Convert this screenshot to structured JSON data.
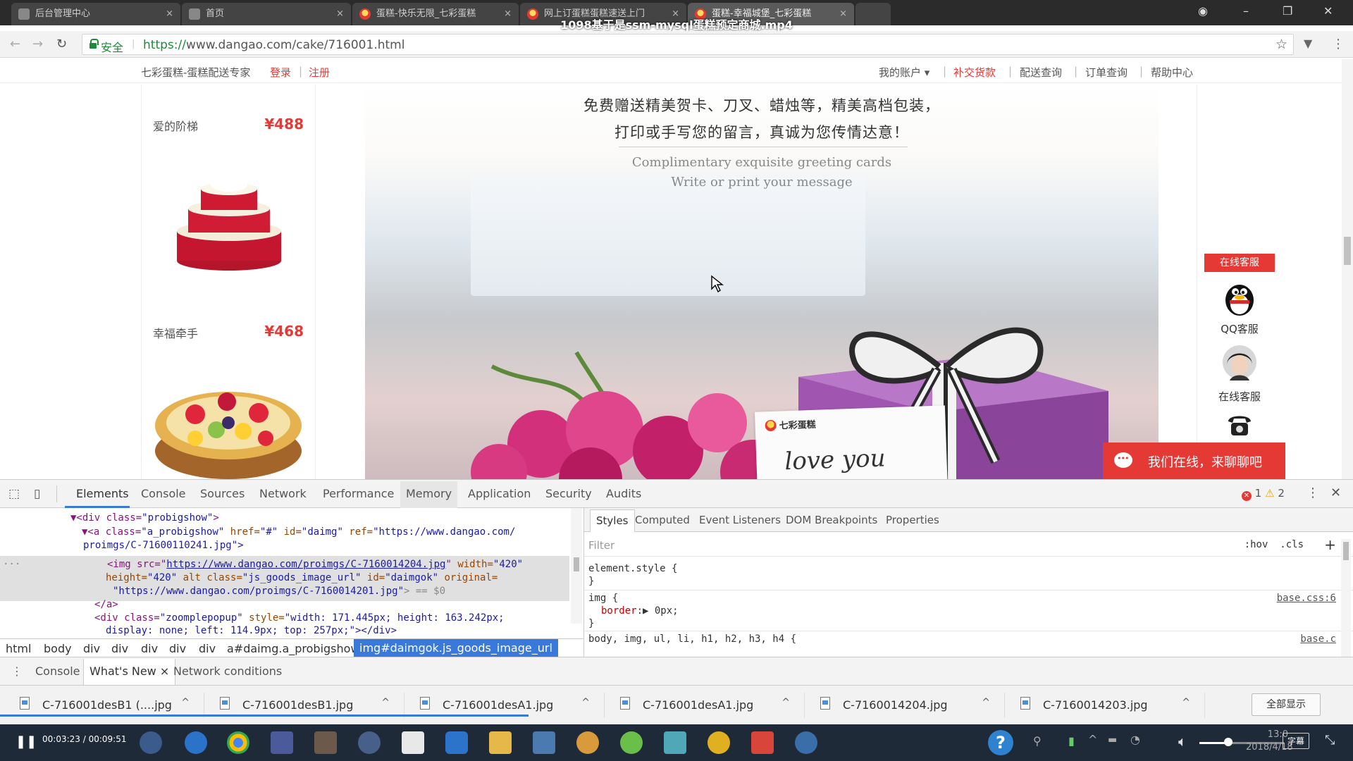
{
  "browser": {
    "video_title": "1098基于是ssm-mysql蛋糕预定商城.mp4",
    "tabs": [
      {
        "label": "后台管理中心",
        "active": false
      },
      {
        "label": "首页",
        "active": false
      },
      {
        "label": "蛋糕-快乐无限_七彩蛋糕",
        "active": false
      },
      {
        "label": "网上订蛋糕蛋糕速送上门",
        "active": false
      },
      {
        "label": "蛋糕-幸福城堡_七彩蛋糕",
        "active": true
      }
    ],
    "tab_close": "×",
    "secure_label": "安全",
    "url_scheme": "https://",
    "url_host": "www.dangao.com",
    "url_path": "/cake/716001.html"
  },
  "site": {
    "brand_tagline": "七彩蛋糕-蛋糕配送专家",
    "login": "登录",
    "register": "注册",
    "my_account": "我的账户 ▾",
    "pay_balance": "补交货款",
    "delivery_query": "配送查询",
    "order_query": "订单查询",
    "help_center": "帮助中心",
    "separator": "|"
  },
  "products": [
    {
      "name": "爱的阶梯",
      "price": "¥488"
    },
    {
      "name": "幸福牵手",
      "price": "¥468"
    }
  ],
  "banner": {
    "cn_line1": "免费赠送精美贺卡、刀叉、蜡烛等，精美高档包装，",
    "cn_line2": "打印或手写您的留言，真诚为您传情达意！",
    "en_line1": "Complimentary exquisite greeting cards",
    "en_line2": "Write or print your message",
    "card_brand": "七彩蛋糕",
    "card_text": "love you"
  },
  "service": {
    "header": "在线客服",
    "qq": "QQ客服",
    "online": "在线客服",
    "chat_bar": "我们在线，来聊聊吧"
  },
  "devtools": {
    "tabs": [
      "Elements",
      "Console",
      "Sources",
      "Network",
      "Performance",
      "Memory",
      "Application",
      "Security",
      "Audits"
    ],
    "errors": "1",
    "warnings": "2",
    "dom": {
      "l1_tag": "▼<div class=",
      "l1_val": "\"probigshow\"",
      "l1_end": ">",
      "l2_a": "▼<a class=",
      "l2_b": "\"a_probigshow\"",
      "l2_c": " href=",
      "l2_d": "\"#\"",
      "l2_e": " id=",
      "l2_f": "\"daimg\"",
      "l2_g": " ref=",
      "l2_h": "\"https://www.dangao.com/",
      "l3": "proimgs/C-71600110241.jpg\">",
      "l4_a": "<img src=",
      "l4_link": "https://www.dangao.com/proimgs/C-7160014204.jpg",
      "l4_b": " width=",
      "l4_c": "\"420\"",
      "l5_a": "height=",
      "l5_b": "\"420\"",
      "l5_c": " alt class=",
      "l5_d": "\"js_goods_image_url\"",
      "l5_e": " id=",
      "l5_f": "\"daimgok\"",
      "l5_g": " original=",
      "l6_a": "\"https://www.dangao.com/proimgs/C-7160014201.jpg\"",
      "l6_b": "> == $0",
      "l7": "</a>",
      "l8_a": "<div class=",
      "l8_b": "\"zoomplepopup\"",
      "l8_c": " style=",
      "l8_d": "\"width: 171.445px; height: 163.242px;",
      "l9": "display: none; left: 114.9px; top: 257px;\"></div>",
      "ellipsis": "..."
    },
    "breadcrumbs": [
      "html",
      "body",
      "div",
      "div",
      "div",
      "div",
      "div",
      "a#daimg.a_probigshow",
      "img#daimgok.js_goods_image_url"
    ],
    "styles_tabs": [
      "Styles",
      "Computed",
      "Event Listeners",
      "DOM Breakpoints",
      "Properties"
    ],
    "filter_placeholder": "Filter",
    "hov": ":hov",
    "cls": ".cls",
    "plus": "+",
    "css": {
      "rule1": "element.style {",
      "close": "}",
      "rule2": "img {",
      "prop": "border",
      "prop_val": ":▶ 0px;",
      "src1": "base.css:6",
      "rule3": "body, img, ul, li, h1, h2, h3, h4 {",
      "src2": "base.c"
    },
    "drawer": {
      "console": "Console",
      "whats_new": "What's New ×",
      "network_conditions": "Network conditions"
    }
  },
  "downloads": {
    "items": [
      "C-716001desB1 (....jpg",
      "C-716001desB1.jpg",
      "C-716001desA1.jpg",
      "C-716001desA1.jpg",
      "C-7160014204.jpg",
      "C-7160014203.jpg"
    ],
    "caret": "^",
    "show_all": "全部显示"
  },
  "taskbar": {
    "video_time": "00:03:23 / 00:09:51",
    "help": "?",
    "clock_time": "13:0",
    "clock_date": "2018/4/18",
    "subtitle_btn": "字幕"
  },
  "colors": {
    "accent_red": "#e53935",
    "secure_green": "#1b8a3a",
    "devtools_blue": "#3879d9"
  }
}
